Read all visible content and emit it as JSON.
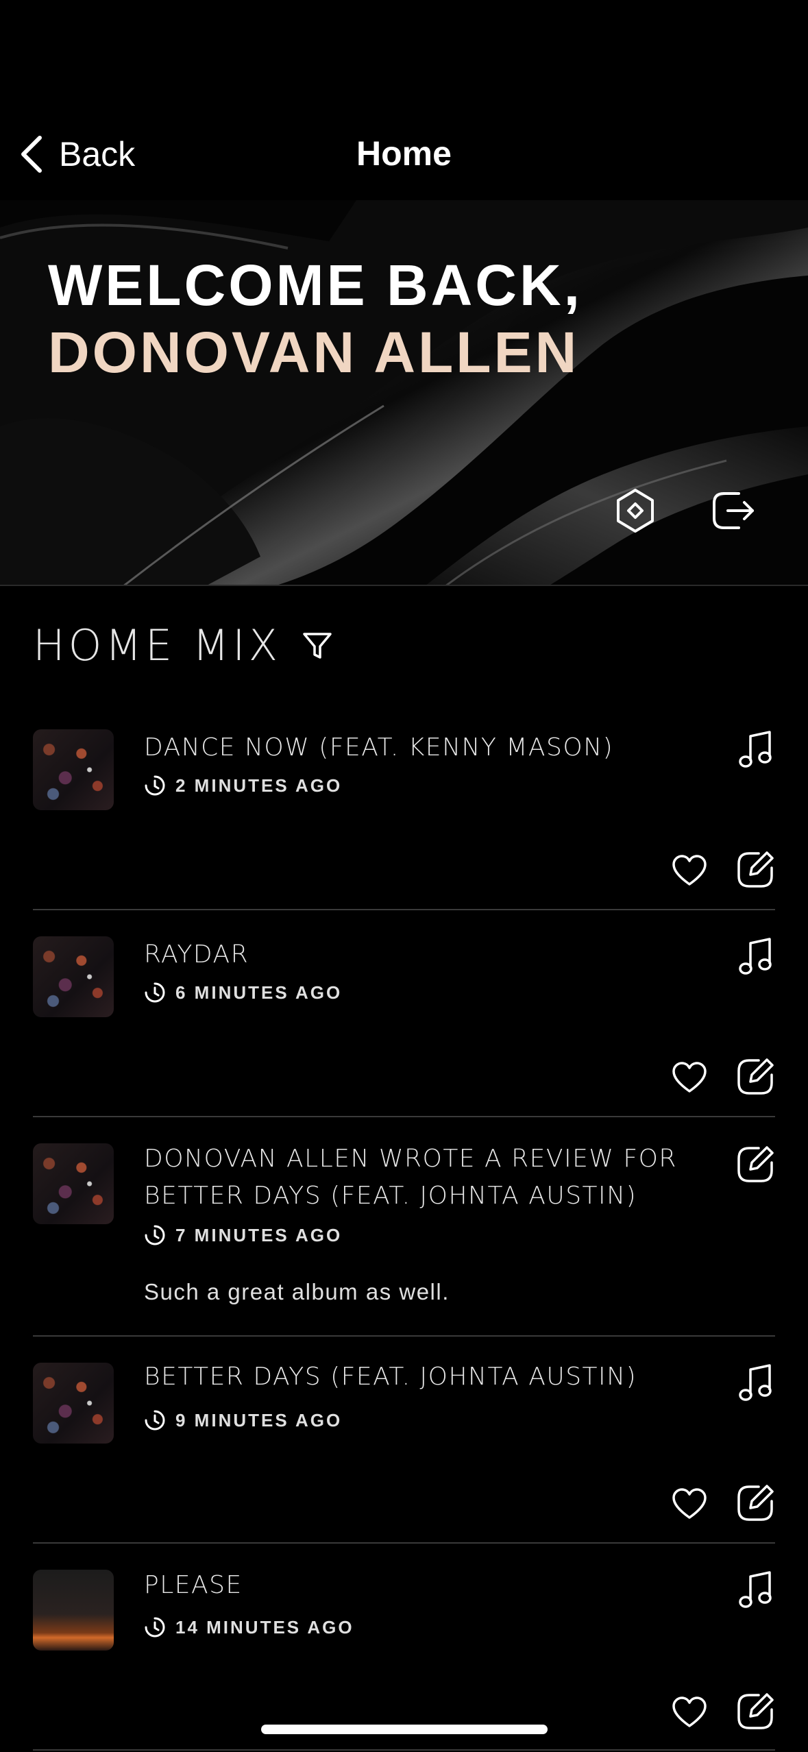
{
  "nav": {
    "back_label": "Back",
    "title": "Home"
  },
  "hero": {
    "welcome_line1": "WELCOME BACK,",
    "welcome_line2": "DONOVAN ALLEN"
  },
  "section": {
    "title": "HOME MIX"
  },
  "feed": [
    {
      "title_lines": [
        "DANCE NOW (FEAT. KENNY MASON)"
      ],
      "time": "2 MINUTES AGO",
      "type": "track"
    },
    {
      "title_lines": [
        "RAYDAR"
      ],
      "time": "6 MINUTES AGO",
      "type": "track"
    },
    {
      "title_lines": [
        "DONOVAN ALLEN WROTE A REVIEW FOR",
        "BETTER DAYS (FEAT. JOHNTA AUSTIN)"
      ],
      "time": "7 MINUTES AGO",
      "type": "review",
      "review": "Such a great album as well."
    },
    {
      "title_lines": [
        "BETTER DAYS (FEAT. JOHNTA AUSTIN)"
      ],
      "time": "9 MINUTES AGO",
      "type": "track"
    },
    {
      "title_lines": [
        "PLEASE"
      ],
      "time": "14 MINUTES AGO",
      "type": "track"
    }
  ],
  "colors": {
    "accent": "#f0d6c2",
    "background": "#000000",
    "divider": "#3a3a3a"
  }
}
